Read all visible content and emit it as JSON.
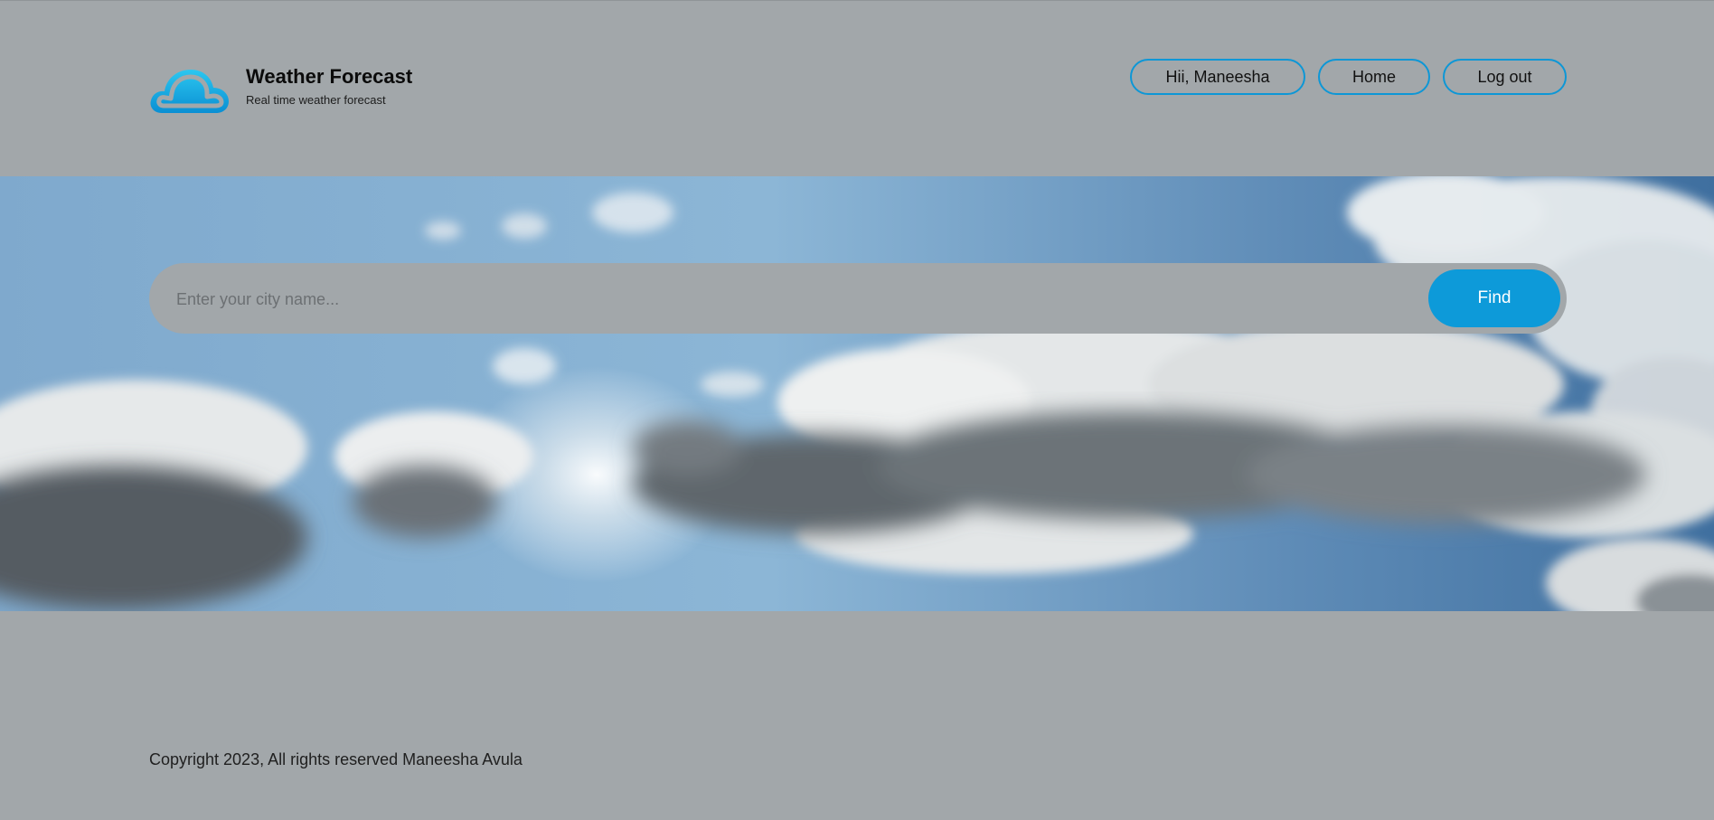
{
  "brand": {
    "logo_icon": "cloud-icon",
    "title": "Weather Forecast",
    "subtitle": "Real time weather forecast",
    "accent_color": "#0d97d6"
  },
  "nav": {
    "greeting": "Hii, Maneesha",
    "home": "Home",
    "logout": "Log out"
  },
  "search": {
    "placeholder": "Enter your city name...",
    "value": "",
    "button_label": "Find"
  },
  "hero": {
    "background": "cloudy-sky-image"
  },
  "footer": {
    "copyright": "Copyright 2023, All rights reserved Maneesha Avula"
  }
}
